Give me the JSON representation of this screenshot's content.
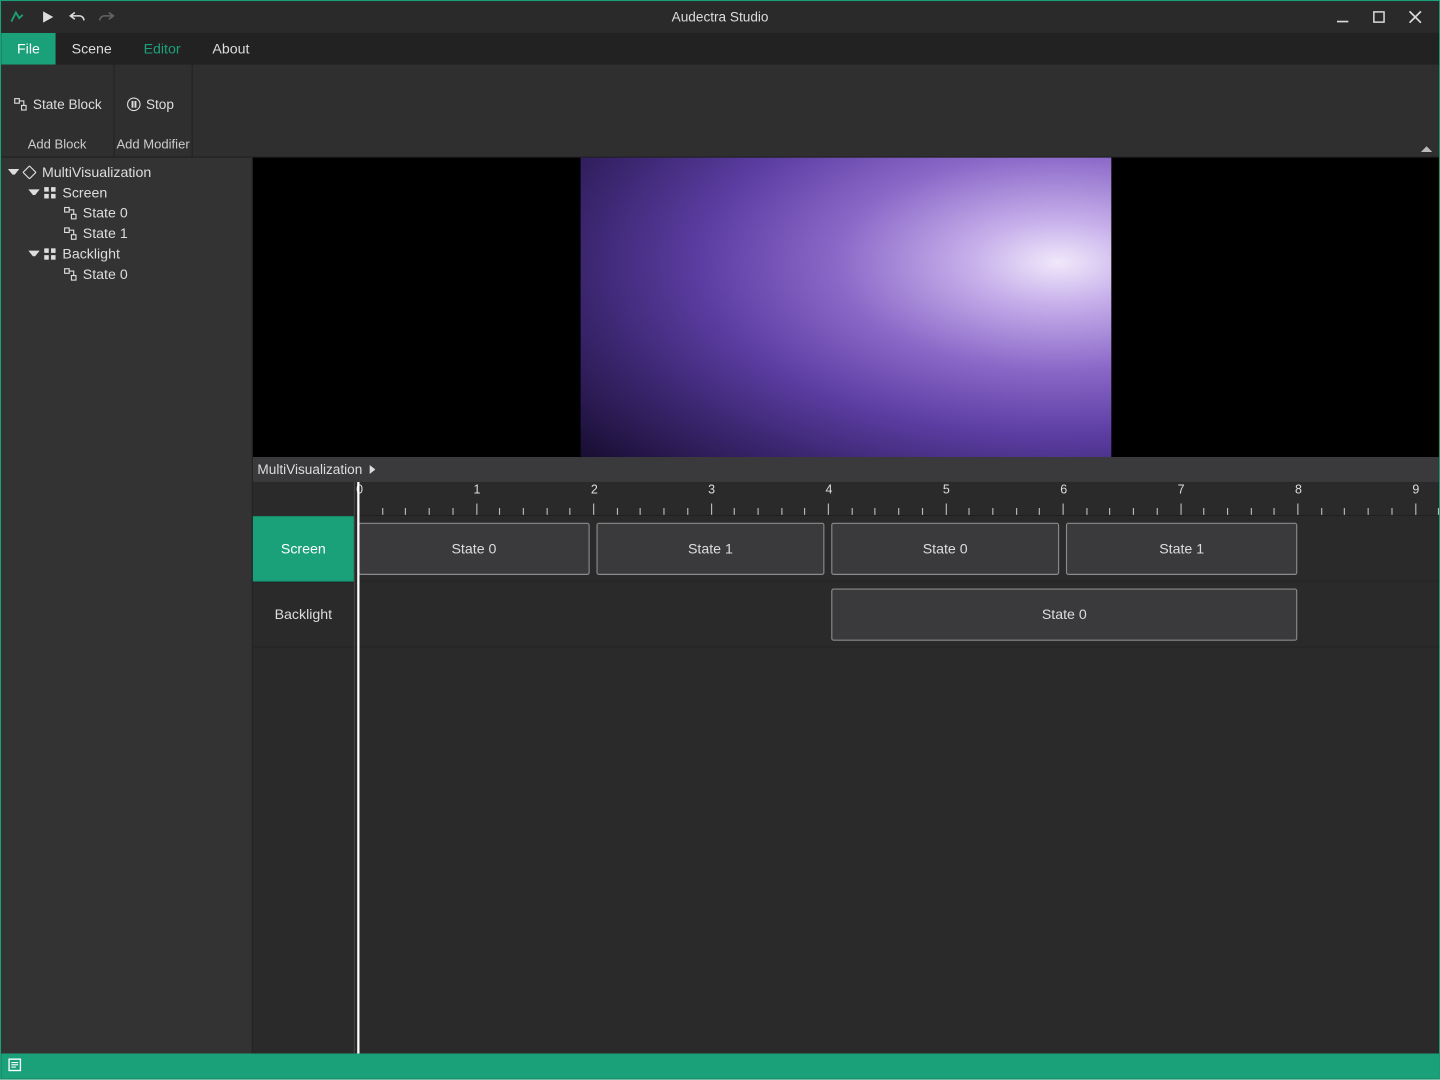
{
  "app": {
    "title": "Audectra Studio"
  },
  "menu": {
    "file": "File",
    "scene": "Scene",
    "editor": "Editor",
    "about": "About",
    "active": "file",
    "highlighted": "editor"
  },
  "ribbon": {
    "groups": [
      {
        "label": "Add Block",
        "buttons": [
          {
            "label": "State Block",
            "icon": "state-block-icon"
          }
        ]
      },
      {
        "label": "Add Modifier",
        "buttons": [
          {
            "label": "Stop",
            "icon": "stop-icon"
          }
        ]
      }
    ]
  },
  "tree": {
    "root": {
      "label": "MultiVisualization",
      "icon": "diamond"
    },
    "children": [
      {
        "label": "Screen",
        "icon": "grid",
        "children": [
          {
            "label": "State 0",
            "icon": "state"
          },
          {
            "label": "State 1",
            "icon": "state"
          }
        ]
      },
      {
        "label": "Backlight",
        "icon": "grid",
        "children": [
          {
            "label": "State 0",
            "icon": "state"
          }
        ]
      }
    ]
  },
  "breadcrumb": {
    "path": "MultiVisualization"
  },
  "timeline": {
    "unitPx": 103.5,
    "majorTicks": [
      0,
      1,
      2,
      3,
      4,
      5,
      6,
      7,
      8,
      9
    ],
    "tracks": [
      {
        "name": "Screen",
        "selected": true,
        "clips": [
          {
            "label": "State 0",
            "start": 0.0,
            "end": 1.97
          },
          {
            "label": "State 1",
            "start": 2.03,
            "end": 3.97
          },
          {
            "label": "State 0",
            "start": 4.03,
            "end": 5.97
          },
          {
            "label": "State 1",
            "start": 6.03,
            "end": 8.0
          }
        ]
      },
      {
        "name": "Backlight",
        "selected": false,
        "clips": [
          {
            "label": "State 0",
            "start": 4.03,
            "end": 8.0
          }
        ]
      }
    ]
  }
}
